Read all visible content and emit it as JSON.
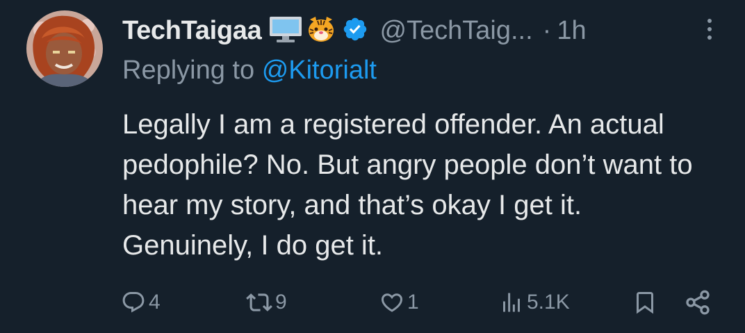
{
  "tweet": {
    "display_name": "TechTaigaa",
    "name_emojis": [
      "desktop-computer-emoji",
      "tiger-face-emoji"
    ],
    "verified": true,
    "handle": "@TechTaig...",
    "separator": "·",
    "timestamp": "1h",
    "replying_prefix": "Replying to",
    "replying_to": "@Kitorialt",
    "text": "Legally I am a registered offender. An actual pedophile? No. But angry people don’t want to hear my story, and that’s okay I get it. Genuinely, I do get it."
  },
  "actions": {
    "replies": "4",
    "reposts": "9",
    "likes": "1",
    "views": "5.1K"
  },
  "colors": {
    "background": "#15202b",
    "text": "#e7e9ea",
    "muted": "#8b98a5",
    "accent": "#1d9bf0"
  }
}
